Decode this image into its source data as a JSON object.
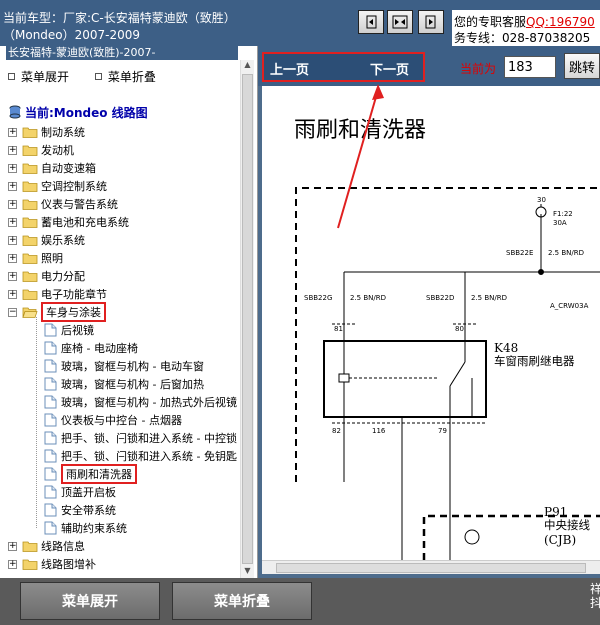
{
  "header": {
    "line1": "当前车型：厂家:C-长安福特蒙迪欧（致胜）",
    "line2": "（Mondeo）2007-2009",
    "service_line1_prefix": "您的专职客服",
    "qq_link": "QQ:196790",
    "service_line2": "务专线：028-87038205"
  },
  "left": {
    "top_caption": "长安福特-蒙迪欧(致胜)-2007-",
    "expand_label": "菜单展开",
    "collapse_label": "菜单折叠",
    "tree_root": "当前:Mondeo 线路图",
    "folders_before": [
      "制动系统",
      "发动机",
      "自动变速箱",
      "空调控制系统",
      "仪表与警告系统",
      "蓄电池和充电系统",
      "娱乐系统",
      "照明",
      "电力分配",
      "电子功能章节"
    ],
    "open_folder": "车身与涂装",
    "children": [
      "后视镜",
      "座椅 - 电动座椅",
      "玻璃，窗框与机构 - 电动车窗",
      "玻璃，窗框与机构 - 后窗加热",
      "玻璃，窗框与机构 - 加热式外后视镜",
      "仪表板与中控台 - 点烟器",
      "把手、锁、闩锁和进入系统 - 中控锁",
      "把手、锁、闩锁和进入系统 - 免钥匙",
      "雨刷和清洗器",
      "顶盖开启板",
      "安全带系统",
      "辅助约束系统"
    ],
    "selected_child": "雨刷和清洗器",
    "folders_after": [
      "线路信息",
      "线路图增补"
    ]
  },
  "nav": {
    "prev": "上一页",
    "next": "下一页",
    "page_label": "当前为",
    "page_value": "183",
    "jump": "跳转"
  },
  "document": {
    "title": "雨刷和清洗器",
    "fuse_num": "30",
    "fuse_name": "F1:22",
    "fuse_amp": "30A",
    "splice1": "SBB22E",
    "wire1": "2.5 BN/RD",
    "splice2": "SBB22G",
    "wire2": "2.5 BN/RD",
    "splice3": "SBB22D",
    "wire3": "2.5 BN/RD",
    "conn": "A_CRW03A",
    "pin81": "81",
    "pin80": "80",
    "relay_id": "K48",
    "relay_name": "车窗雨刷继电器",
    "pin82": "82",
    "pin116": "116",
    "pin79": "79",
    "cjb_id": "P91",
    "cjb_name": "中央接线",
    "cjb_abbr": "(CJB)"
  },
  "bottom": {
    "expand": "菜单展开",
    "collapse": "菜单折叠",
    "right_text": "祥抖"
  },
  "colors": {
    "header_bg": "#3d5f86",
    "highlight": "#e02020",
    "qq": "#e00000"
  }
}
